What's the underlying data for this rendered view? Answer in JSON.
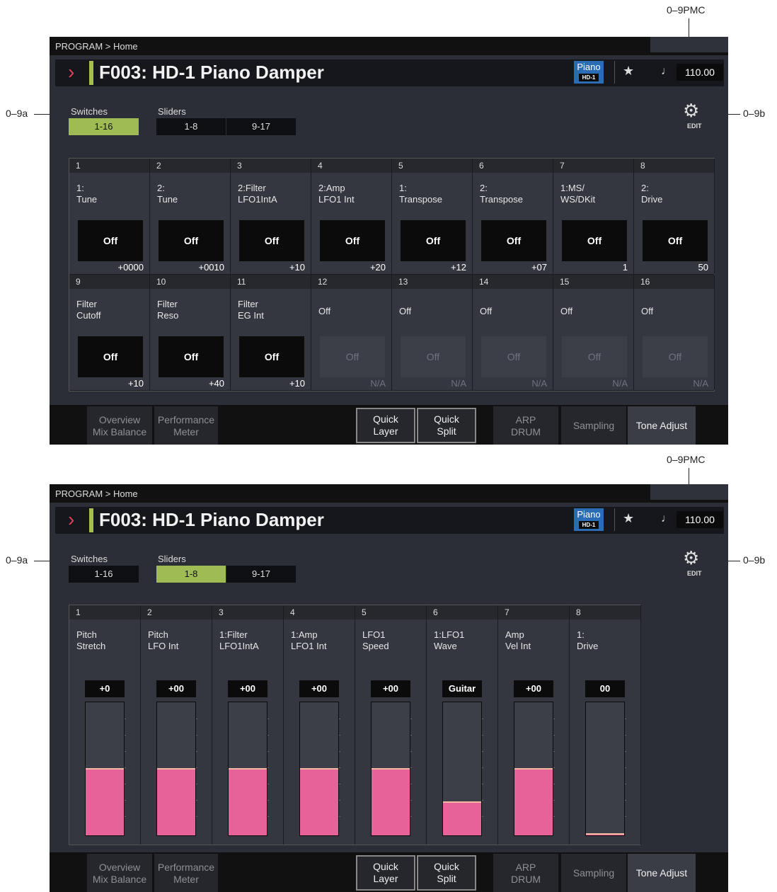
{
  "callouts": {
    "pmc": "0–9PMC",
    "a": "0–9a",
    "b": "0–9b"
  },
  "breadcrumb": "PROGRAM > Home",
  "program": {
    "title": "F003: HD-1 Piano Damper",
    "category": "Piano",
    "engine": "HD-1",
    "tempo": "110.00",
    "favorite_icon": "star-icon",
    "tempo_icon": "quarter-note-icon"
  },
  "groups": {
    "switches": "Switches",
    "sliders": "Sliders"
  },
  "segments": {
    "switches_1_16": "1-16",
    "sliders_1_8": "1-8",
    "sliders_9_17": "9-17"
  },
  "edit_label": "EDIT",
  "colors": {
    "accent": "#a4c14e",
    "selected": "#9fbb53",
    "slider_fill": "#e8629a",
    "category": "#2a6db5",
    "chevron": "#e0405a"
  },
  "screen1": {
    "selected_group": "switches",
    "switches": [
      {
        "num": "1",
        "name": "1:\nTune",
        "state": "Off",
        "value": "+0000",
        "enabled": true
      },
      {
        "num": "2",
        "name": "2:\nTune",
        "state": "Off",
        "value": "+0010",
        "enabled": true
      },
      {
        "num": "3",
        "name": "2:Filter\nLFO1IntA",
        "state": "Off",
        "value": "+10",
        "enabled": true
      },
      {
        "num": "4",
        "name": "2:Amp\nLFO1 Int",
        "state": "Off",
        "value": "+20",
        "enabled": true
      },
      {
        "num": "5",
        "name": "1:\nTranspose",
        "state": "Off",
        "value": "+12",
        "enabled": true
      },
      {
        "num": "6",
        "name": "2:\nTranspose",
        "state": "Off",
        "value": "+07",
        "enabled": true
      },
      {
        "num": "7",
        "name": "1:MS/\nWS/DKit",
        "state": "Off",
        "value": "1",
        "enabled": true
      },
      {
        "num": "8",
        "name": "2:\nDrive",
        "state": "Off",
        "value": "50",
        "enabled": true
      },
      {
        "num": "9",
        "name": "Filter\nCutoff",
        "state": "Off",
        "value": "+10",
        "enabled": true
      },
      {
        "num": "10",
        "name": "Filter\nReso",
        "state": "Off",
        "value": "+40",
        "enabled": true
      },
      {
        "num": "11",
        "name": "Filter\nEG Int",
        "state": "Off",
        "value": "+10",
        "enabled": true
      },
      {
        "num": "12",
        "name": "Off",
        "state": "Off",
        "value": "N/A",
        "enabled": false
      },
      {
        "num": "13",
        "name": "Off",
        "state": "Off",
        "value": "N/A",
        "enabled": false
      },
      {
        "num": "14",
        "name": "Off",
        "state": "Off",
        "value": "N/A",
        "enabled": false
      },
      {
        "num": "15",
        "name": "Off",
        "state": "Off",
        "value": "N/A",
        "enabled": false
      },
      {
        "num": "16",
        "name": "Off",
        "state": "Off",
        "value": "N/A",
        "enabled": false
      }
    ]
  },
  "screen2": {
    "selected_group": "sliders_1_8",
    "sliders": [
      {
        "num": "1",
        "name": "Pitch\nStretch",
        "value": "+0",
        "level": 0.5
      },
      {
        "num": "2",
        "name": "Pitch\nLFO Int",
        "value": "+00",
        "level": 0.5
      },
      {
        "num": "3",
        "name": "1:Filter\nLFO1IntA",
        "value": "+00",
        "level": 0.5
      },
      {
        "num": "4",
        "name": "1:Amp\nLFO1 Int",
        "value": "+00",
        "level": 0.5
      },
      {
        "num": "5",
        "name": "LFO1\nSpeed",
        "value": "+00",
        "level": 0.5
      },
      {
        "num": "6",
        "name": "1:LFO1\nWave",
        "value": "Guitar",
        "level": 0.25
      },
      {
        "num": "7",
        "name": "Amp\nVel Int",
        "value": "+00",
        "level": 0.5
      },
      {
        "num": "8",
        "name": "1:\nDrive",
        "value": "00",
        "level": 0.0
      }
    ]
  },
  "tabs": [
    {
      "l1": "Overview",
      "l2": "Mix Balance"
    },
    {
      "l1": "Performance",
      "l2": "Meter"
    },
    {
      "l1": "Quick",
      "l2": "Layer"
    },
    {
      "l1": "Quick",
      "l2": "Split"
    },
    {
      "l1": "ARP",
      "l2": "DRUM"
    },
    {
      "l1": "Sampling",
      "l2": ""
    },
    {
      "l1": "Tone Adjust",
      "l2": ""
    }
  ]
}
